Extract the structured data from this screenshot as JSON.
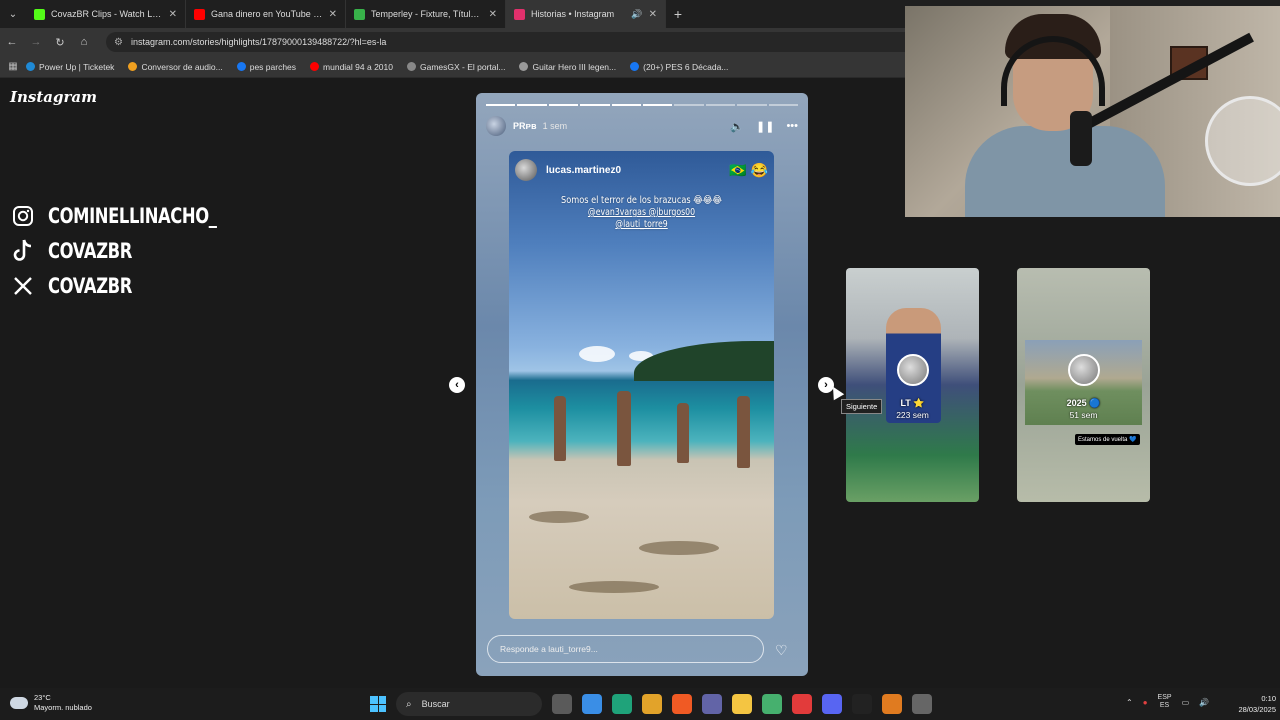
{
  "browser": {
    "tabs": [
      {
        "title": "CovazBR Clips - Watch Live on",
        "color": "#53fc18",
        "active": false
      },
      {
        "title": "Gana dinero en YouTube - You",
        "color": "#ff0000",
        "active": false
      },
      {
        "title": "Temperley - Fixture, Títulos y Pl",
        "color": "#38b24a",
        "active": false
      },
      {
        "title": "Historias • Instagram",
        "color": "#e1306c",
        "active": true
      }
    ],
    "url": "instagram.com/stories/highlights/17879000139488722/?hl=es-la",
    "bookmarks": [
      {
        "label": "Power Up | Ticketek",
        "color": "#1f8ad6"
      },
      {
        "label": "Conversor de audio...",
        "color": "#f0a020"
      },
      {
        "label": "pes parches",
        "color": "#1877f2"
      },
      {
        "label": "mundial 94 a 2010",
        "color": "#ff0000"
      },
      {
        "label": "GamesGX - El portal...",
        "color": "#888888"
      },
      {
        "label": "Guitar Hero III legen...",
        "color": "#999999"
      },
      {
        "label": "(20+) PES 6 Década...",
        "color": "#1877f2"
      }
    ]
  },
  "instagram": {
    "logo": "Instagram",
    "socials": [
      {
        "icon": "instagram-icon",
        "handle": "COMINELLINACHO_"
      },
      {
        "icon": "tiktok-icon",
        "handle": "COVAZBR"
      },
      {
        "icon": "x-icon",
        "handle": "COVAZBR"
      }
    ],
    "story": {
      "progress_segments": 10,
      "progress_completed": 6,
      "user": "PRᴘʙ",
      "time": "1 sem",
      "inner_user": "lucas.martinez0",
      "inner_emoji": "🇧🇷 😂",
      "caption": "Somos el terror de los brazucas 😂😂😂",
      "mentions": [
        "@evan3vargas @jburgos00",
        "@lauti_torre9"
      ],
      "reply_placeholder": "Responde a lauti_torre9..."
    },
    "previews": [
      {
        "name": "LT ⭐",
        "time": "223 sem"
      },
      {
        "name": "2025 🔵",
        "time": "51 sem",
        "badge": "Estamos de vuelta 💙"
      }
    ],
    "tooltip": "Siguiente"
  },
  "taskbar": {
    "weather_temp": "23°C",
    "weather_desc": "Mayorm. nublado",
    "search_placeholder": "Buscar",
    "lang_top": "ESP",
    "lang_bottom": "ES",
    "time": "0:10",
    "date": "28/03/2025"
  }
}
